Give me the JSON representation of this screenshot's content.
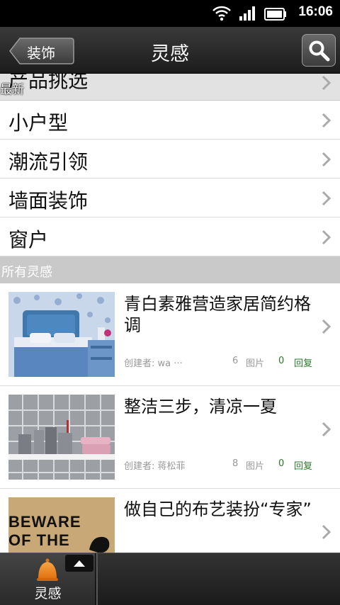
{
  "status": {
    "time": "16:06"
  },
  "header": {
    "back_label": "装饰",
    "title": "灵感"
  },
  "category_partial": {
    "label": "产品挑选",
    "overlay": "最新"
  },
  "categories": [
    {
      "label": "小户型"
    },
    {
      "label": "潮流引领"
    },
    {
      "label": "墙面装饰"
    },
    {
      "label": "窗户"
    }
  ],
  "section_title": "所有灵感",
  "items": [
    {
      "title": "青白素雅营造家居简约格调",
      "creator": "创建者: wa ···",
      "photo_count": "6",
      "photo_label": "图片",
      "reply_count": "0",
      "reply_label": "回复"
    },
    {
      "title": "整洁三步，清凉一夏",
      "creator": "创建者: 蒋松菲",
      "photo_count": "8",
      "photo_label": "图片",
      "reply_count": "0",
      "reply_label": "回复"
    },
    {
      "title": "做自己的布艺装扮“专家”",
      "creator": "",
      "photo_count": "",
      "photo_label": "",
      "reply_count": "",
      "reply_label": ""
    }
  ],
  "thumb_text": {
    "line1": "BEWARE",
    "line2": "OF THE"
  },
  "tabbar": {
    "active_label": "灵感"
  },
  "colors": {
    "accent_orange": "#f08a1c",
    "reply_green": "#2a7a2a",
    "section_gray": "#c9c9c9"
  }
}
